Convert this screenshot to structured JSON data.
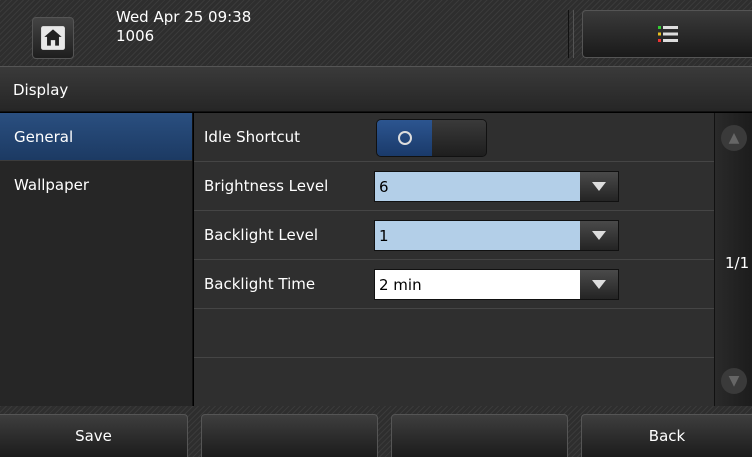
{
  "header": {
    "datetime": "Wed Apr 25 09:38",
    "extension": "1006"
  },
  "title": "Display",
  "sidebar": {
    "items": [
      {
        "label": "General"
      },
      {
        "label": "Wallpaper"
      }
    ]
  },
  "settings": {
    "idle_shortcut": {
      "label": "Idle Shortcut",
      "enabled": true
    },
    "brightness": {
      "label": "Brightness Level",
      "value": "6"
    },
    "backlight_level": {
      "label": "Backlight Level",
      "value": "1"
    },
    "backlight_time": {
      "label": "Backlight Time",
      "value": "2 min"
    }
  },
  "pager": {
    "text": "1/1"
  },
  "softkeys": {
    "save": "Save",
    "back": "Back"
  },
  "colors": {
    "selected_item": "#1f4170",
    "field_highlight": "#b3cfe8"
  }
}
